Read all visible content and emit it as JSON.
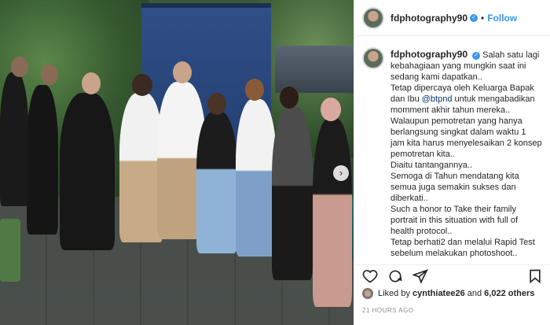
{
  "post": {
    "username": "fdphotography90",
    "follow_label": "Follow",
    "separator": "•",
    "caption_lines": [
      "Salah satu lagi kebahagiaan yang mungkin saat ini sedang kami dapatkan..",
      "Tetap dipercaya oleh Keluarga Bapak dan Ibu",
      "untuk mengabadikan momment akhir tahun mereka..",
      "Walaupun pemotretan yang hanya berlangsung singkat dalam waktu 1 jam kita harus menyelesaikan 2 konsep pemotretan kita..",
      "Diaitu tantangannya..",
      "Semoga di Tahun mendatang kita semua juga semakin sukses dan diberkati..",
      "Such a honor to Take their family portrait in this situation with full of health protocol..",
      "Tetap berhati2 dan melalui Rapid Test sebelum melakukan photoshoot.."
    ],
    "mention": "@btpnd",
    "likes_user": "cynthiatee26",
    "likes_text": " and ",
    "likes_count": "6,022 others",
    "likes_prefix": "Liked by ",
    "timestamp": "21 HOURS AGO"
  },
  "colors": {
    "accent": "#3897f0",
    "verified": "#3897f0",
    "mention": "#00376b"
  },
  "icons": [
    "heart-icon",
    "comment-icon",
    "share-icon",
    "bookmark-icon",
    "verified-icon",
    "chevron-right-icon"
  ]
}
